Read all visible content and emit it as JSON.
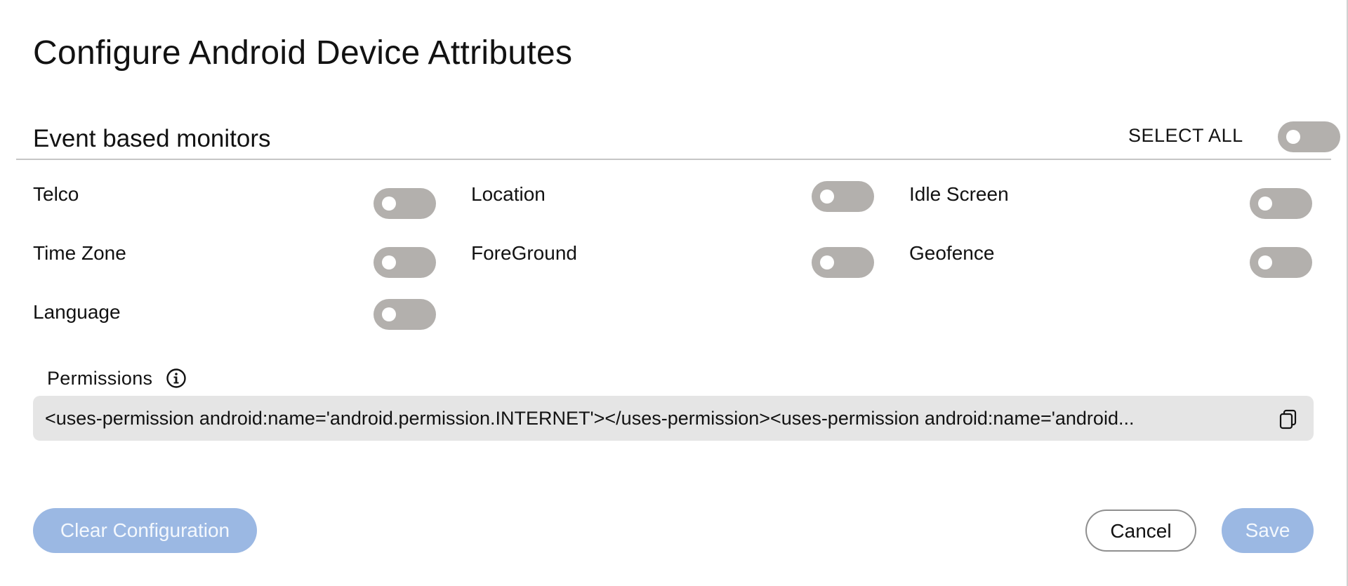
{
  "dialog": {
    "title": "Configure Android Device Attributes"
  },
  "section": {
    "title": "Event based monitors",
    "select_all_label": "SELECT ALL",
    "select_all_on": false
  },
  "attributes": {
    "telco": {
      "label": "Telco",
      "enabled": false
    },
    "location": {
      "label": "Location",
      "enabled": false
    },
    "idle_screen": {
      "label": "Idle Screen",
      "enabled": false
    },
    "time_zone": {
      "label": "Time Zone",
      "enabled": false
    },
    "foreground": {
      "label": "ForeGround",
      "enabled": false
    },
    "geofence": {
      "label": "Geofence",
      "enabled": false
    },
    "language": {
      "label": "Language",
      "enabled": false
    }
  },
  "permissions": {
    "label": "Permissions",
    "value": "<uses-permission android:name='android.permission.INTERNET'></uses-permission><uses-permission android:name='android..."
  },
  "footer": {
    "clear_label": "Clear Configuration",
    "cancel_label": "Cancel",
    "save_label": "Save"
  },
  "colors": {
    "toggle_off": "#b3b0ad",
    "primary_disabled": "#9bb8e3",
    "field_background": "#e5e5e5"
  },
  "icons": {
    "info": "info-icon",
    "copy": "copy-icon",
    "toggle_knob": "toggle-knob"
  }
}
